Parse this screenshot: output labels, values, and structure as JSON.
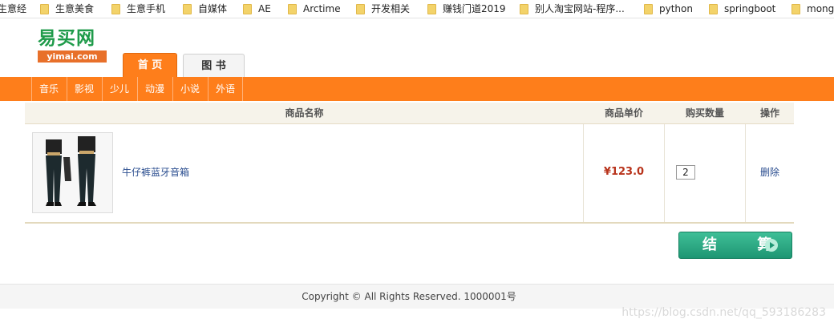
{
  "bookmarks": [
    {
      "label": "生意经",
      "folder": false
    },
    {
      "label": "生意美食",
      "folder": true
    },
    {
      "label": "生意手机",
      "folder": true
    },
    {
      "label": "自媒体",
      "folder": true
    },
    {
      "label": "AE",
      "folder": true
    },
    {
      "label": "Arctime",
      "folder": true
    },
    {
      "label": "开发相关",
      "folder": true
    },
    {
      "label": "赚钱门道2019",
      "folder": true
    },
    {
      "label": "别人淘宝网站-程序...",
      "folder": true
    },
    {
      "label": "python",
      "folder": true
    },
    {
      "label": "springboot",
      "folder": true
    },
    {
      "label": "mong",
      "folder": true
    }
  ],
  "logo": {
    "name": "易买网",
    "domain": "yimai.com"
  },
  "tabs": [
    {
      "label": "首 页",
      "active": true
    },
    {
      "label": "图 书",
      "active": false
    }
  ],
  "nav": [
    "音乐",
    "影视",
    "少儿",
    "动漫",
    "小说",
    "外语"
  ],
  "cart": {
    "headers": {
      "name": "商品名称",
      "price": "商品单价",
      "qty": "购买数量",
      "action": "操作"
    },
    "items": [
      {
        "name": "牛仔裤蓝牙音箱",
        "price": "¥123.0",
        "qty": "2",
        "delete_label": "删除"
      }
    ]
  },
  "checkout_label": "结 算",
  "footer": {
    "copyright": "Copyright © All Rights Reserved. 1000001号"
  },
  "watermark": "https://blog.csdn.net/qq_593186283",
  "colors": {
    "accent": "#fe7e1b",
    "logo_green": "#1f9b4a",
    "price": "#b8321a",
    "checkout": "#1e9673"
  }
}
